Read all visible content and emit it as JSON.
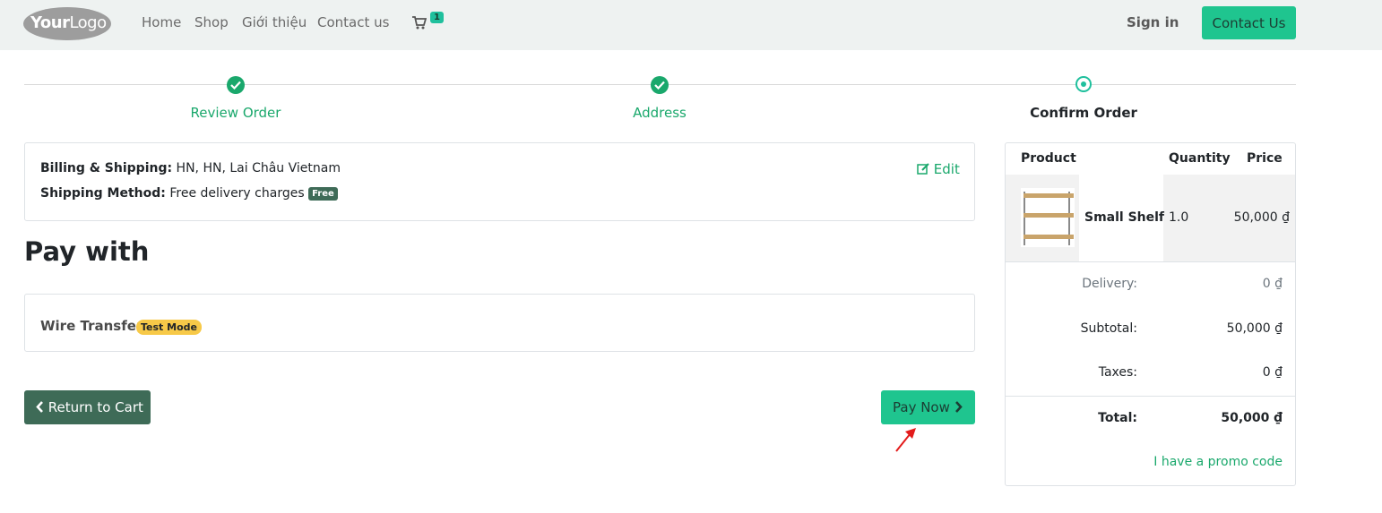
{
  "header": {
    "logo_text_bold": "Your",
    "logo_text": "Logo",
    "nav": [
      "Home",
      "Shop",
      "Giới thiệu",
      "Contact us"
    ],
    "cart_count": "1",
    "sign_in": "Sign in",
    "contact_button": "Contact Us"
  },
  "steps": [
    {
      "label": "Review Order",
      "state": "done"
    },
    {
      "label": "Address",
      "state": "done"
    },
    {
      "label": "Confirm Order",
      "state": "current"
    }
  ],
  "billing": {
    "billing_label": "Billing & Shipping:",
    "billing_value": "HN, HN, Lai Châu Vietnam",
    "shipping_label": "Shipping Method:",
    "shipping_value": "Free delivery charges",
    "shipping_badge": "Free",
    "edit_label": "Edit"
  },
  "payment": {
    "title": "Pay with",
    "method_name": "Wire Transfer",
    "method_badge": "Test Mode"
  },
  "actions": {
    "return_label": "Return to Cart",
    "pay_label": "Pay Now"
  },
  "summary": {
    "headers": {
      "product": "Product",
      "quantity": "Quantity",
      "price": "Price"
    },
    "items": [
      {
        "name": "Small Shelf",
        "quantity": "1.0",
        "price": "50,000 ₫"
      }
    ],
    "delivery_label": "Delivery:",
    "delivery_value": "0 ₫",
    "subtotal_label": "Subtotal:",
    "subtotal_value": "50,000 ₫",
    "taxes_label": "Taxes:",
    "taxes_value": "0 ₫",
    "total_label": "Total:",
    "total_value": "50,000 ₫",
    "promo_label": "I have a promo code"
  },
  "colors": {
    "primary": "#1fc58f",
    "secondary": "#3e6b57",
    "success": "#1aa86c",
    "warning": "#f7c948"
  }
}
